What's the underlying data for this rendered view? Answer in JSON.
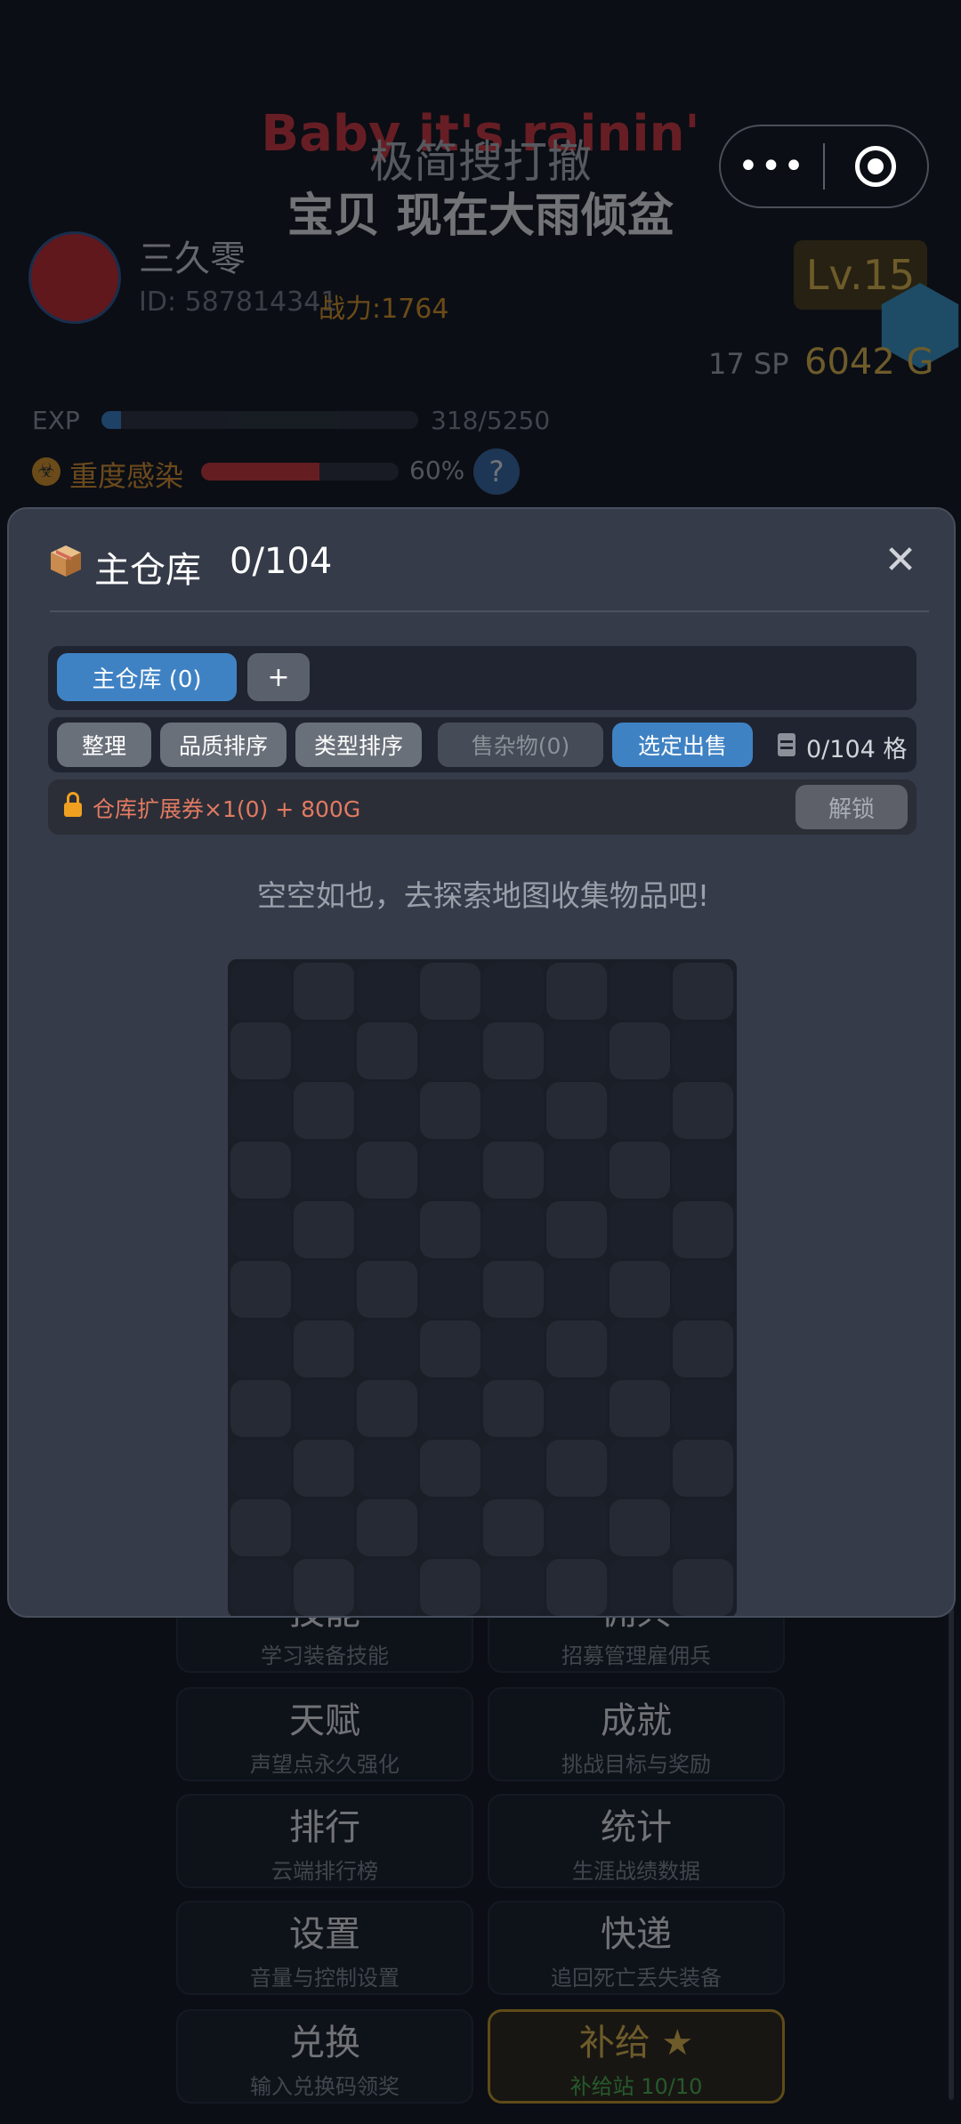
{
  "background": {
    "lyric_en": "Baby it's rainin'",
    "app_title": "极简搜打撤",
    "lyric_zh": "宝贝 现在大雨倾盆",
    "player": {
      "name": "三久零",
      "id_text": "ID: 587814341",
      "power_text": "战力:1764",
      "level": "Lv.15",
      "sp": "17 SP",
      "gold": "6042 G"
    },
    "exp": {
      "label": "EXP",
      "text": "318/5250",
      "progress": 0.061
    },
    "infection": {
      "label": "重度感染",
      "percent_text": "60%",
      "progress": 0.6,
      "help": "?"
    },
    "menu": [
      {
        "title": "技能",
        "subtitle": "学习装备技能"
      },
      {
        "title": "佣兵",
        "subtitle": "招募管理雇佣兵"
      },
      {
        "title": "天赋",
        "subtitle": "声望点永久强化"
      },
      {
        "title": "成就",
        "subtitle": "挑战目标与奖励"
      },
      {
        "title": "排行",
        "subtitle": "云端排行榜"
      },
      {
        "title": "统计",
        "subtitle": "生涯战绩数据"
      },
      {
        "title": "设置",
        "subtitle": "音量与控制设置"
      },
      {
        "title": "快递",
        "subtitle": "追回死亡丢失装备"
      },
      {
        "title": "兑换",
        "subtitle": "输入兑换码领奖"
      },
      {
        "title": "补给 ★",
        "subtitle": "补给站 10/10"
      }
    ]
  },
  "capsule": {
    "more_label": "•••"
  },
  "modal": {
    "title": "主仓库",
    "count": "0/104",
    "close_label": "✕",
    "tabs": {
      "main": "主仓库 (0)",
      "add": "+"
    },
    "toolbar": {
      "sort": "整理",
      "quality_sort": "品质排序",
      "type_sort": "类型排序",
      "sell_junk": "售杂物(0)",
      "sell_selected": "选定出售",
      "capacity": "0/104 格"
    },
    "unlock": {
      "text": "仓库扩展券×1(0) + 800G",
      "button": "解锁"
    },
    "empty_message": "空空如也，去探索地图收集物品吧!",
    "grid": {
      "columns": 8,
      "rows_visible": 11
    }
  },
  "colors": {
    "accent_blue": "#3f82c4",
    "gold": "#f5c64a",
    "danger_red": "#e03535",
    "modal_bg": "#353b48"
  }
}
